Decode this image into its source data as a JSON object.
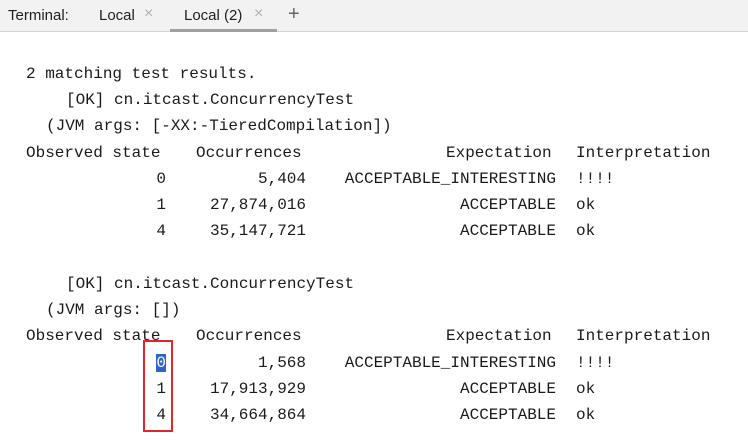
{
  "tabbar": {
    "label": "Terminal:",
    "tabs": [
      {
        "label": "Local"
      },
      {
        "label": "Local (2)"
      }
    ],
    "close_glyph": "×",
    "add_glyph": "+"
  },
  "output": {
    "summary": "2 matching test results.",
    "headers": [
      "Observed state",
      "Occurrences",
      "Expectation",
      "Interpretation"
    ],
    "results": [
      {
        "status": "[OK] cn.itcast.ConcurrencyTest",
        "jvm_args": "(JVM args: [-XX:-TieredCompilation])",
        "rows": [
          {
            "state": "0",
            "occurrences": "5,404",
            "expectation": "ACCEPTABLE_INTERESTING",
            "interpretation": "!!!!"
          },
          {
            "state": "1",
            "occurrences": "27,874,016",
            "expectation": "ACCEPTABLE",
            "interpretation": "ok"
          },
          {
            "state": "4",
            "occurrences": "35,147,721",
            "expectation": "ACCEPTABLE",
            "interpretation": "ok"
          }
        ]
      },
      {
        "status": "[OK] cn.itcast.ConcurrencyTest",
        "jvm_args": "(JVM args: [])",
        "rows": [
          {
            "state": "0",
            "occurrences": "1,568",
            "expectation": "ACCEPTABLE_INTERESTING",
            "interpretation": "!!!!"
          },
          {
            "state": "1",
            "occurrences": "17,913,929",
            "expectation": "ACCEPTABLE",
            "interpretation": "ok"
          },
          {
            "state": "4",
            "occurrences": "34,664,864",
            "expectation": "ACCEPTABLE",
            "interpretation": "ok"
          }
        ]
      }
    ]
  },
  "colors": {
    "selection": "#2f65ca",
    "annotation_box": "#e0262b"
  }
}
